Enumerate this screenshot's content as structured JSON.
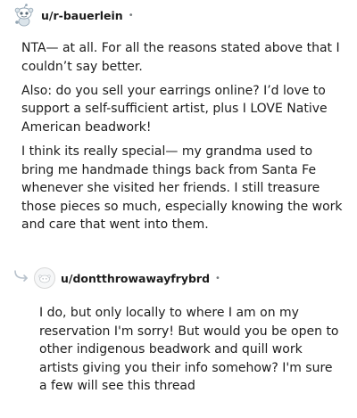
{
  "comment": {
    "username": "u/r-bauerlein",
    "separator": "•",
    "paragraphs": [
      "NTA— at all. For all the reasons stated above that I couldn’t say better.",
      "Also: do you sell your earrings online? I’d love to support a self-sufficient artist, plus I LOVE Native American beadwork!",
      "I think its really special— my grandma used to bring me handmade things back from Santa Fe whenever she visited her friends. I still treasure those pieces so much, especially knowing the work and care that went into them."
    ]
  },
  "reply": {
    "username": "u/dontthrowawayfrybrd",
    "separator": "•",
    "paragraphs": [
      "I do, but only locally to where I am on my reservation I'm sorry! But would you be open to other indigenous beadwork and quill work artists giving you their info somehow? I'm sure a few will see this thread"
    ]
  },
  "icons": {
    "comment_avatar": "snoo-avatar-icon",
    "reply_avatar": "default-avatar-icon",
    "reply_indicator": "reply-arrow-icon"
  },
  "colors": {
    "text": "#1c1c1c",
    "meta": "#787c7e",
    "reply_arrow": "#b8c2cc"
  }
}
